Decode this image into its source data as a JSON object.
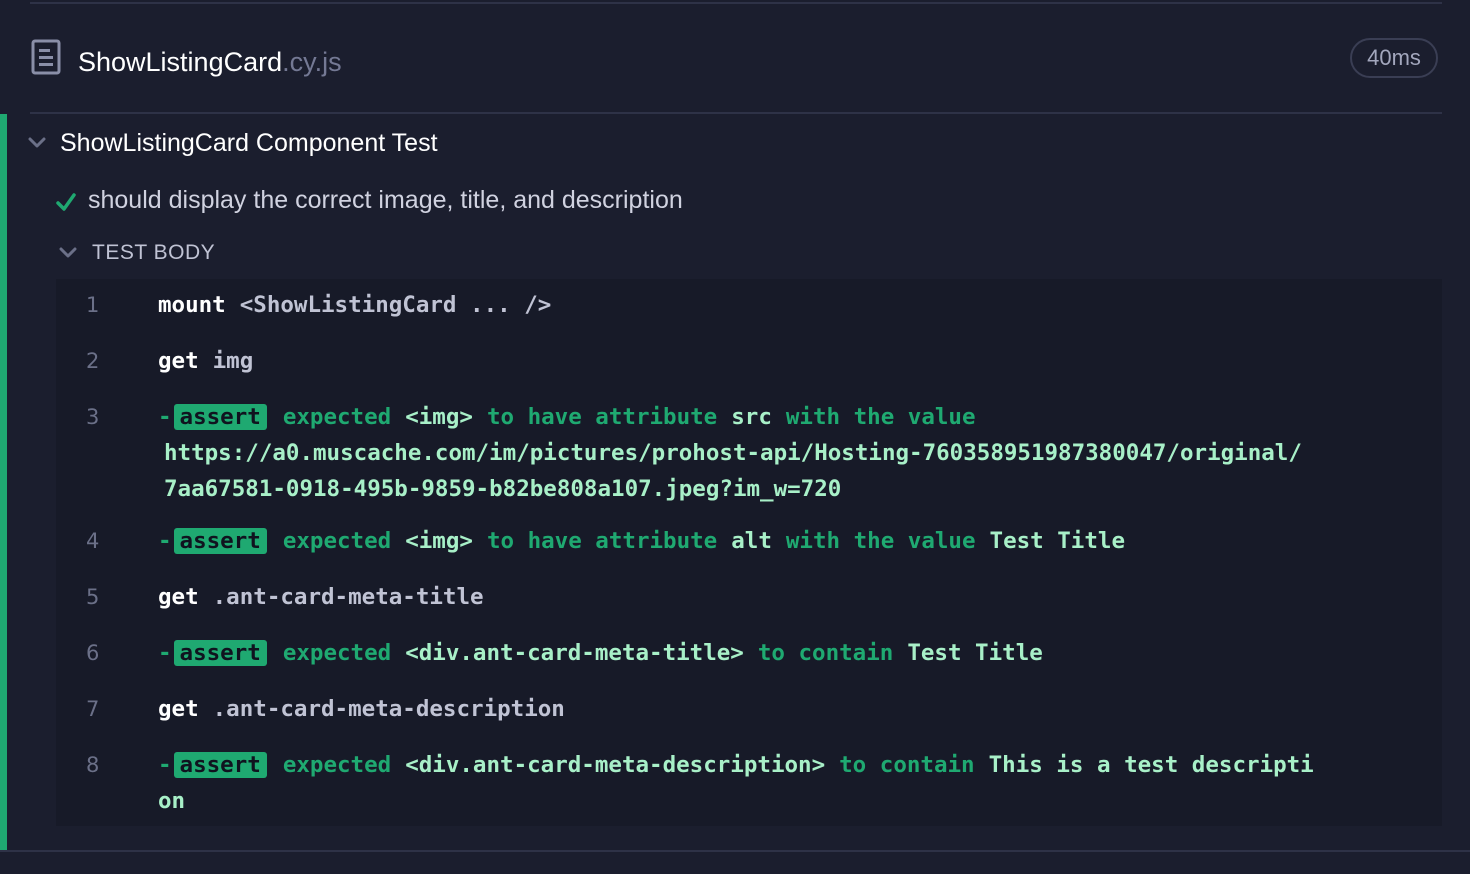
{
  "spec": {
    "base": "ShowListingCard",
    "ext": ".cy.js",
    "duration": "40ms"
  },
  "suite": {
    "title": "ShowListingCard Component Test"
  },
  "test": {
    "title": "should display the correct image, title, and description"
  },
  "test_body": {
    "label": "TEST BODY"
  },
  "commands": [
    {
      "n": "1",
      "name": "mount",
      "message": "<ShowListingCard ... />"
    },
    {
      "n": "2",
      "name": "get",
      "message": "img"
    },
    {
      "n": "3",
      "badge": "assert",
      "parts": {
        "a": "expected",
        "b": "<img>",
        "c": "to have attribute",
        "d": "src",
        "e": "with the value",
        "f": "https://a0.muscache.com/im/pictures/prohost-api/Hosting-760358951987380047/original/7aa67581-0918-495b-9859-b82be808a107.jpeg?im_w=720"
      }
    },
    {
      "n": "4",
      "badge": "assert",
      "parts": {
        "a": "expected",
        "b": "<img>",
        "c": "to have attribute",
        "d": "alt",
        "e": "with the value",
        "f": "Test Title"
      }
    },
    {
      "n": "5",
      "name": "get",
      "message": ".ant-card-meta-title"
    },
    {
      "n": "6",
      "badge": "assert",
      "parts": {
        "a": "expected",
        "b": "<div.ant-card-meta-title>",
        "c": "to contain",
        "d": "Test Title"
      }
    },
    {
      "n": "7",
      "name": "get",
      "message": ".ant-card-meta-description"
    },
    {
      "n": "8",
      "badge": "assert",
      "parts": {
        "a": "expected",
        "b": "<div.ant-card-meta-description>",
        "c": "to contain",
        "d": "This is a test description"
      }
    }
  ],
  "colors": {
    "background": "#1b1e2e",
    "panel": "#171a28",
    "pass": "#1fa971",
    "assert_value": "#a8f0c8"
  },
  "icons": {
    "file": "document-icon",
    "collapse": "chevron-down-icon",
    "pass": "checkmark-icon"
  }
}
